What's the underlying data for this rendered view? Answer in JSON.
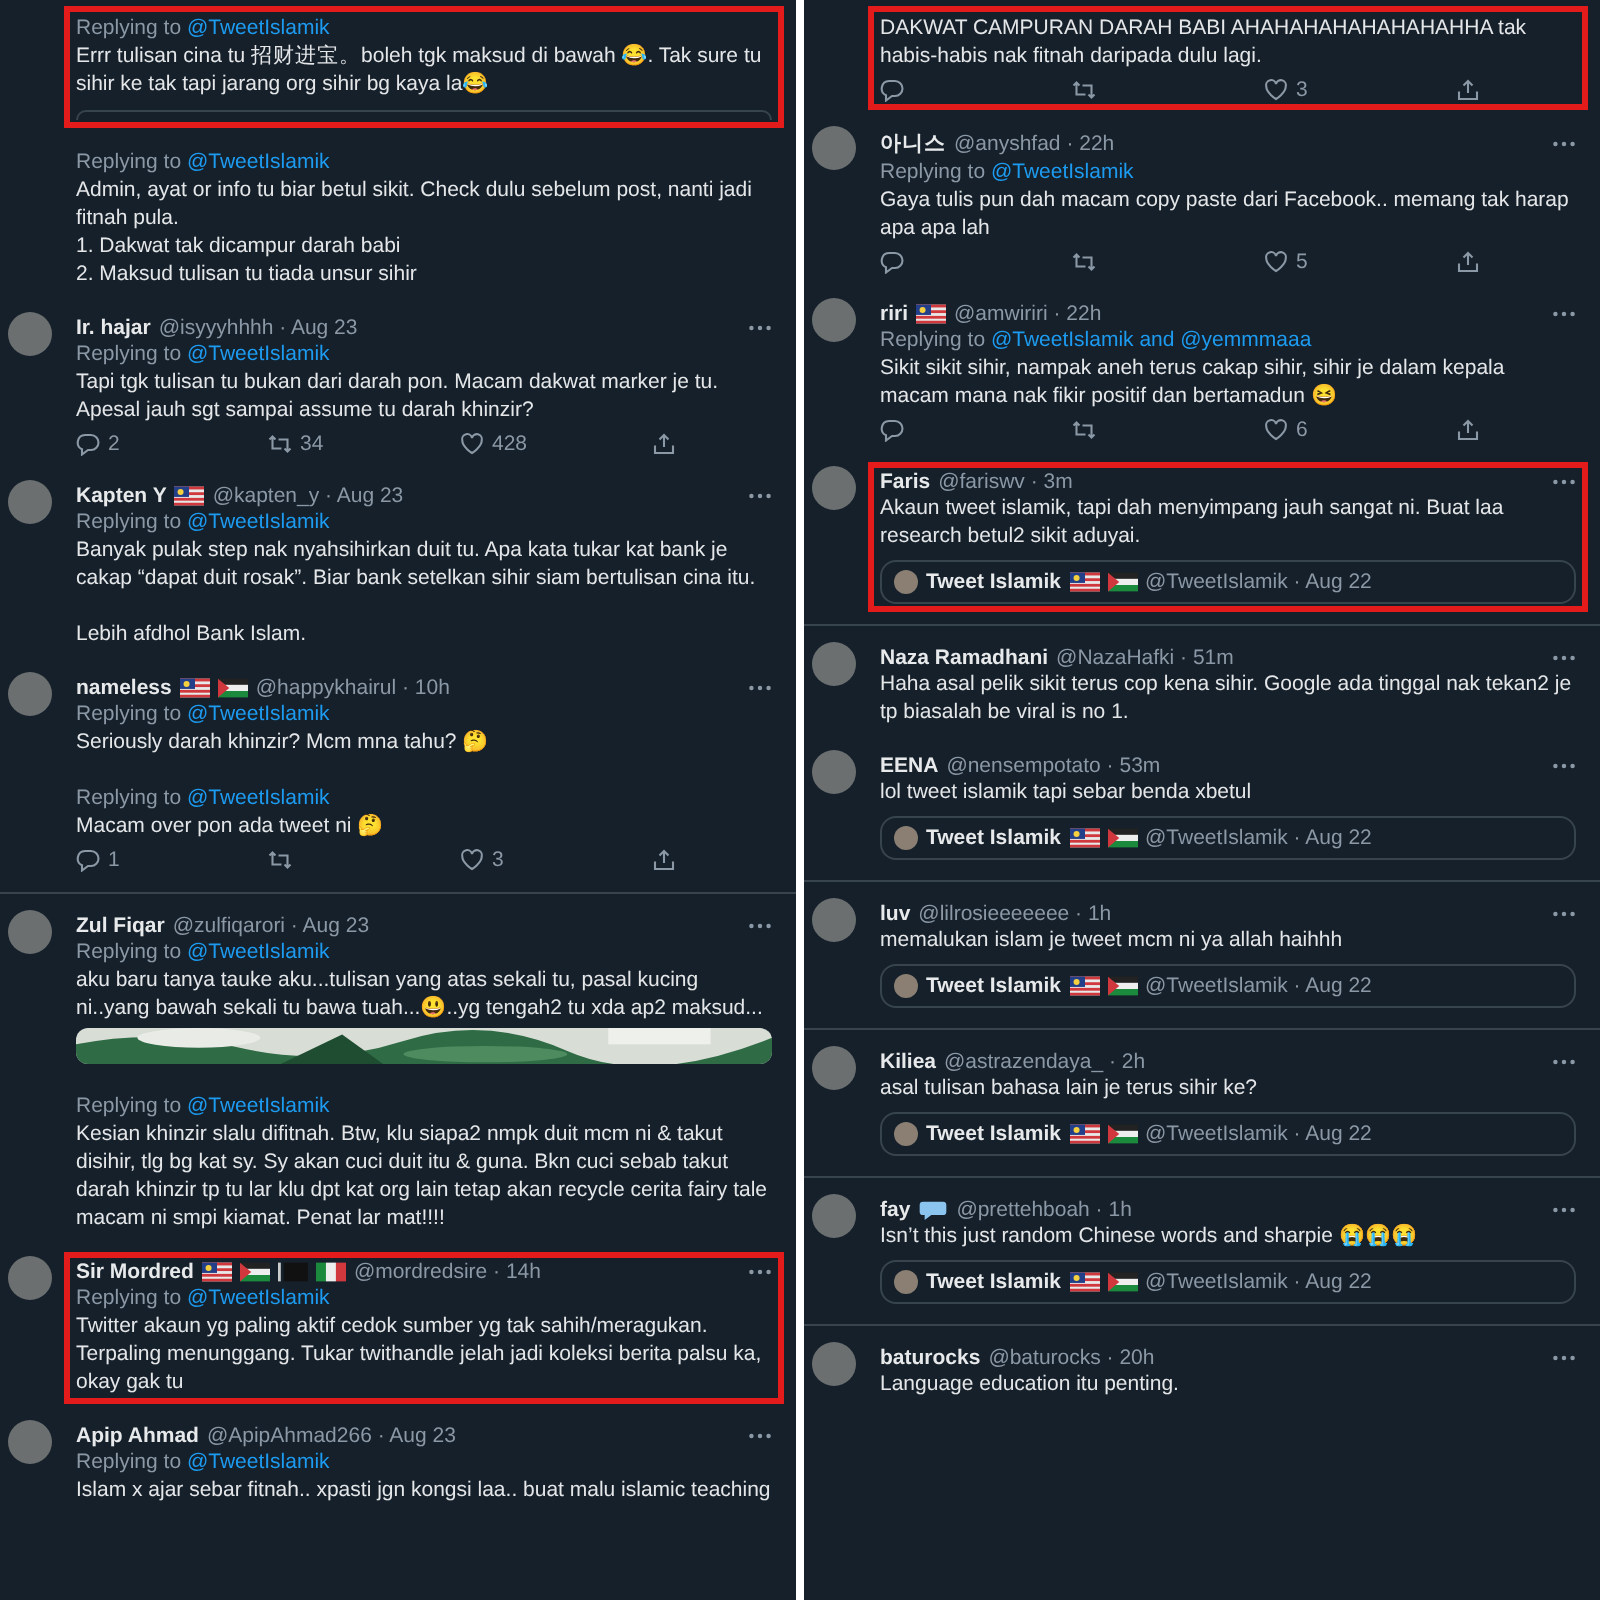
{
  "columns": [
    {
      "tweets": [
        {
          "replying": {
            "prefix": "Replying to",
            "mentions": "@TweetIslamik"
          },
          "text": "Errr tulisan cina tu 招财进宝。boleh tgk maksud di bawah 😂.  Tak sure tu sihir ke tak tapi jarang org sihir bg kaya la😂",
          "highlighted": true,
          "quote_edge": true
        },
        {
          "replying": {
            "prefix": "Replying to",
            "mentions": "@TweetIslamik"
          },
          "text": "Admin, ayat or info tu biar betul sikit. Check dulu sebelum post, nanti jadi fitnah pula.\n1. Dakwat tak dicampur darah babi\n2. Maksud tulisan tu tiada unsur sihir",
          "highlighted": false
        },
        {
          "name": "Ir. hajar",
          "handle": "@isyyyhhhh · Aug 23",
          "replying": {
            "prefix": "Replying to",
            "mentions": "@TweetIslamik"
          },
          "text": "Tapi tgk tulisan tu bukan dari darah pon. Macam dakwat marker je tu.\nApesal jauh sgt sampai assume tu darah khinzir?",
          "highlighted": false,
          "actions": {
            "replies": "2",
            "retweets": "34",
            "likes": "428"
          }
        },
        {
          "name": "Kapten Y",
          "flags": [
            {
              "kind": "malaysia"
            }
          ],
          "handle": "@kapten_y · Aug 23",
          "replying": {
            "prefix": "Replying to",
            "mentions": "@TweetIslamik"
          },
          "text": "Banyak pulak step nak nyahsihirkan duit tu. Apa kata tukar kat bank je cakap “dapat duit rosak”. Biar bank setelkan sihir siam bertulisan cina itu.\n\nLebih afdhol Bank Islam.",
          "highlighted": false
        },
        {
          "name": "nameless",
          "flags": [
            {
              "kind": "malaysia"
            },
            {
              "kind": "palestine"
            }
          ],
          "handle": "@happykhairul · 10h",
          "replying": {
            "prefix": "Replying to",
            "mentions": "@TweetIslamik"
          },
          "text": "Seriously darah khinzir? Mcm mna tahu? 🤔",
          "highlighted": false
        },
        {
          "replying": {
            "prefix": "Replying to",
            "mentions": "@TweetIslamik"
          },
          "text": "Macam over pon ada tweet ni 🤔",
          "highlighted": false,
          "actions": {
            "replies": "1",
            "likes": "3"
          },
          "divider": true
        },
        {
          "name": "Zul Fiqar",
          "handle": "@zulfiqarori · Aug 23",
          "replying": {
            "prefix": "Replying to",
            "mentions": "@TweetIslamik"
          },
          "text": "aku baru tanya tauke aku...tulisan yang atas sekali tu, pasal kucing ni..yang bawah sekali tu bawa tuah...😃..yg tengah2 tu xda ap2 maksud...",
          "highlighted": false
        },
        {
          "replying": {
            "prefix": "Replying to",
            "mentions": "@TweetIslamik"
          },
          "text": "Kesian khinzir slalu difitnah. Btw,  klu siapa2 nmpk duit mcm ni & takut disihir, tlg bg kat sy. Sy akan cuci duit itu & guna. Bkn cuci sebab takut darah khinzir tp tu lar klu dpt kat org lain tetap akan recycle cerita fairy tale macam ni smpi kiamat. Penat lar mat!!!!",
          "highlighted": false
        },
        {
          "name": "Sir Mordred",
          "flags": [
            {
              "kind": "malaysia"
            },
            {
              "kind": "palestine"
            },
            {
              "kind": "black"
            },
            {
              "kind": "italy"
            }
          ],
          "handle": "@mordredsire · 14h",
          "replying": {
            "prefix": "Replying to",
            "mentions": "@TweetIslamik"
          },
          "text": "Twitter akaun yg paling aktif cedok sumber yg tak sahih/meragukan. Terpaling menunggang. Tukar twithandle jelah jadi koleksi berita palsu ka, okay gak tu",
          "highlighted": true
        },
        {
          "name": "Apip Ahmad",
          "handle": "@ApipAhmad266 · Aug 23",
          "replying": {
            "prefix": "Replying to",
            "mentions": "@TweetIslamik"
          },
          "text": "Islam x ajar sebar fitnah.. xpasti jgn kongsi laa.. buat malu islamic teaching",
          "highlighted": false
        }
      ]
    },
    {
      "tweets": [
        {
          "text": "DAKWAT CAMPURAN DARAH BABI AHAHAHAHAHAHAHAHHA tak habis-habis nak fitnah daripada dulu lagi.",
          "highlighted": true,
          "actions": {
            "likes": "3"
          }
        },
        {
          "name": "아니스",
          "handle": "@anyshfad · 22h",
          "replying": {
            "prefix": "Replying to",
            "mentions": "@TweetIslamik"
          },
          "text": "Gaya tulis pun dah macam copy paste dari Facebook.. memang tak harap apa apa lah",
          "highlighted": false,
          "actions": {
            "likes": "5"
          }
        },
        {
          "name": "riri",
          "flags": [
            {
              "kind": "malaysia"
            }
          ],
          "handle": "@amwiriri · 22h",
          "replying": {
            "prefix": "Replying to",
            "mentions": "@TweetIslamik and @yemmmaaa"
          },
          "text": "Sikit sikit sihir, nampak aneh terus cakap sihir, sihir je dalam kepala macam mana nak fikir positif dan bertamadun 😆",
          "highlighted": false,
          "actions": {
            "likes": "6"
          }
        },
        {
          "name": "Faris",
          "handle": "@fariswv · 3m",
          "text": "Akaun tweet islamik, tapi dah menyimpang jauh sangat ni. Buat laa research betul2 sikit aduyai.",
          "highlighted": true,
          "quote": {
            "name": "Tweet Islamik",
            "flags": [
              {
                "kind": "malaysia"
              },
              {
                "kind": "palestine"
              }
            ],
            "handle": "@TweetIslamik · Aug 22"
          },
          "divider": true
        },
        {
          "name": "Naza Ramadhani",
          "handle": "@NazaHafki · 51m",
          "text": "Haha asal pelik sikit terus cop kena sihir. Google ada tinggal nak tekan2 je tp biasalah be viral is no 1.",
          "highlighted": false
        },
        {
          "name": "EENA",
          "handle": "@nensempotato · 53m",
          "text": "lol tweet islamik tapi sebar benda xbetul",
          "highlighted": false,
          "quote": {
            "name": "Tweet Islamik",
            "flags": [
              {
                "kind": "malaysia"
              },
              {
                "kind": "palestine"
              }
            ],
            "handle": "@TweetIslamik · Aug 22"
          },
          "divider": true
        },
        {
          "name": "luv",
          "handle": "@lilrosieeeeeee · 1h",
          "text": "memalukan islam je tweet mcm ni ya allah haihhh",
          "highlighted": false,
          "quote": {
            "name": "Tweet Islamik",
            "flags": [
              {
                "kind": "malaysia"
              },
              {
                "kind": "palestine"
              }
            ],
            "handle": "@TweetIslamik · Aug 22"
          },
          "divider": true
        },
        {
          "name": "Kiliea",
          "handle": "@astrazendaya_ · 2h",
          "text": "asal tulisan bahasa lain je terus sihir ke?",
          "highlighted": false,
          "quote": {
            "name": "Tweet Islamik",
            "flags": [
              {
                "kind": "malaysia"
              },
              {
                "kind": "palestine"
              }
            ],
            "handle": "@TweetIslamik · Aug 22"
          },
          "divider": true
        },
        {
          "name": "fay",
          "flags": [
            {
              "kind": "bubble"
            }
          ],
          "handle": "@prettehboah · 1h",
          "text": "Isn’t this just random Chinese words and sharpie 😭😭😭",
          "highlighted": false,
          "quote": {
            "name": "Tweet Islamik",
            "flags": [
              {
                "kind": "malaysia"
              },
              {
                "kind": "palestine"
              }
            ],
            "handle": "@TweetIslamik · Aug 22"
          },
          "divider": true
        },
        {
          "name": "baturocks",
          "handle": "@baturocks · 20h",
          "text": "Language education itu penting.",
          "highlighted": false
        }
      ]
    }
  ]
}
